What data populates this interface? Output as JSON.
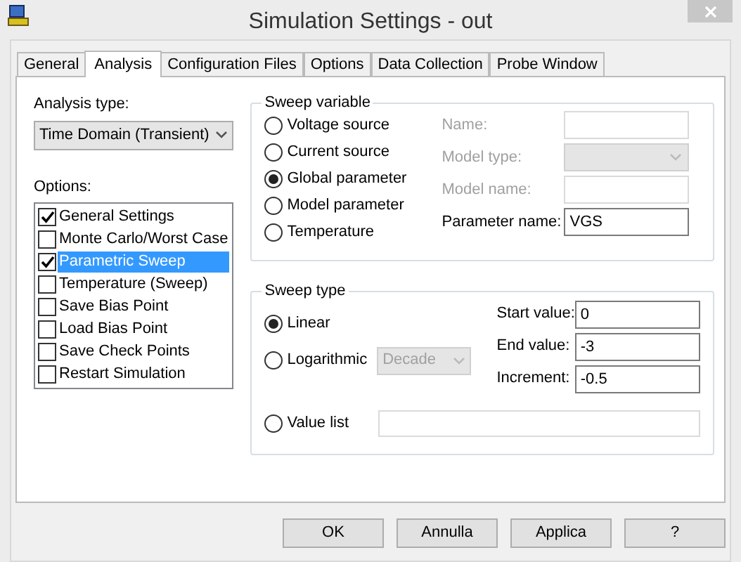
{
  "window": {
    "title": "Simulation Settings - out"
  },
  "tabs": [
    {
      "label": "General",
      "selected": false
    },
    {
      "label": "Analysis",
      "selected": true
    },
    {
      "label": "Configuration Files",
      "selected": false
    },
    {
      "label": "Options",
      "selected": false
    },
    {
      "label": "Data Collection",
      "selected": false
    },
    {
      "label": "Probe Window",
      "selected": false
    }
  ],
  "analysis_type": {
    "label": "Analysis type:",
    "value": "Time Domain (Transient)"
  },
  "options": {
    "label": "Options:",
    "items": [
      {
        "label": "General Settings",
        "checked": true,
        "selected": false
      },
      {
        "label": "Monte Carlo/Worst Case",
        "checked": false,
        "selected": false
      },
      {
        "label": "Parametric Sweep",
        "checked": true,
        "selected": true
      },
      {
        "label": "Temperature (Sweep)",
        "checked": false,
        "selected": false
      },
      {
        "label": "Save Bias Point",
        "checked": false,
        "selected": false
      },
      {
        "label": "Load Bias Point",
        "checked": false,
        "selected": false
      },
      {
        "label": "Save Check Points",
        "checked": false,
        "selected": false
      },
      {
        "label": "Restart Simulation",
        "checked": false,
        "selected": false
      }
    ]
  },
  "sweep_variable": {
    "title": "Sweep variable",
    "choices": [
      {
        "label": "Voltage source",
        "selected": false
      },
      {
        "label": "Current source",
        "selected": false
      },
      {
        "label": "Global parameter",
        "selected": true
      },
      {
        "label": "Model parameter",
        "selected": false
      },
      {
        "label": "Temperature",
        "selected": false
      }
    ],
    "fields": [
      {
        "label": "Name:",
        "kind": "text",
        "disabled": true
      },
      {
        "label": "Model type:",
        "kind": "dropdown",
        "disabled": true
      },
      {
        "label": "Model name:",
        "kind": "text",
        "disabled": true
      },
      {
        "label": "Parameter name:",
        "kind": "text",
        "disabled": false,
        "value": "VGS"
      }
    ]
  },
  "sweep_type": {
    "title": "Sweep type",
    "choices": [
      {
        "label": "Linear",
        "selected": true
      },
      {
        "label": "Logarithmic",
        "selected": false
      },
      {
        "label": "Value list",
        "selected": false
      }
    ],
    "log_scale": {
      "value": "Decade",
      "disabled": true
    },
    "fields": [
      {
        "label": "Start value:",
        "value": "0"
      },
      {
        "label": "End value:",
        "value": "-3"
      },
      {
        "label": "Increment:",
        "value": "-0.5"
      }
    ]
  },
  "buttons": [
    "OK",
    "Annulla",
    "Applica",
    "?"
  ]
}
